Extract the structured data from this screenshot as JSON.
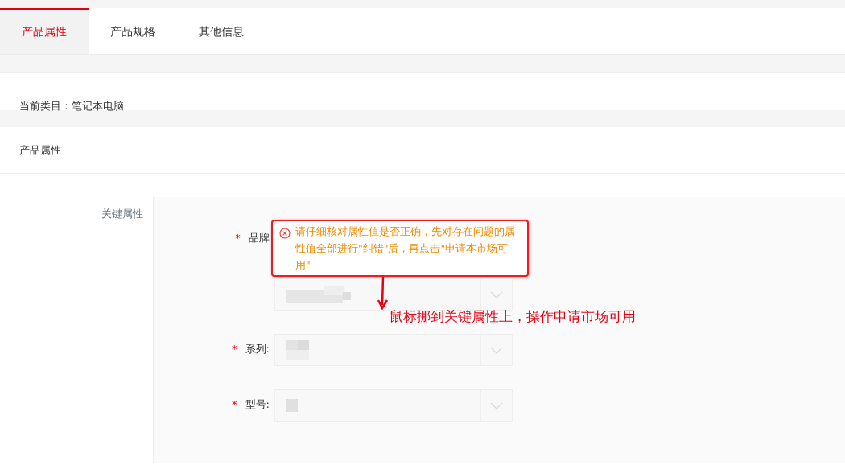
{
  "tabs": [
    {
      "label": "产品属性",
      "selected": true
    },
    {
      "label": "产品规格",
      "selected": false
    },
    {
      "label": "其他信息",
      "selected": false
    }
  ],
  "category": {
    "text": "当前类目：笔记本电脑"
  },
  "section": {
    "title": "产品属性",
    "group_label": "关键属性",
    "fields": [
      {
        "label": "品牌",
        "required_mark": "*"
      },
      {
        "label": "系列:",
        "required_mark": "*"
      },
      {
        "label": "型号:",
        "required_mark": "*"
      }
    ]
  },
  "error": {
    "message": "请仔细核对属性值是否正确，先对存在问题的属性值全部进行\"纠错\"后，再点击\"申请本市场可用\""
  },
  "annotation": {
    "text": "鼠标挪到关键属性上，操作申请市场可用"
  }
}
